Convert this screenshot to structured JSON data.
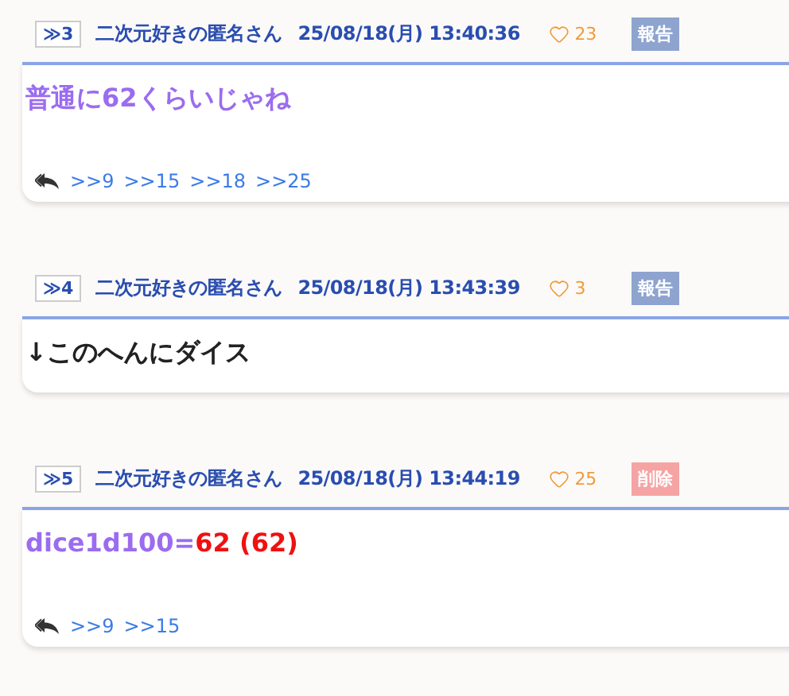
{
  "posts": [
    {
      "number": "≫3",
      "name": "二次元好きの匿名さん",
      "date": "25/08/18(月) 13:40:36",
      "likes": "23",
      "action": {
        "kind": "report",
        "label": "報告"
      },
      "body": [
        {
          "text": "普通に62くらいじゃね",
          "color": "#9b6cf0"
        }
      ],
      "replies": [
        ">>9",
        ">>15",
        ">>18",
        ">>25"
      ]
    },
    {
      "number": "≫4",
      "name": "二次元好きの匿名さん",
      "date": "25/08/18(月) 13:43:39",
      "likes": "3",
      "action": {
        "kind": "report",
        "label": "報告"
      },
      "body": [
        {
          "text": "↓このへんにダイス",
          "color": "#222222"
        }
      ]
    },
    {
      "number": "≫5",
      "name": "二次元好きの匿名さん",
      "date": "25/08/18(月) 13:44:19",
      "likes": "25",
      "action": {
        "kind": "delete",
        "label": "削除"
      },
      "body": [
        {
          "text": "dice1d100=",
          "color": "#9b6cf0"
        },
        {
          "text": "62 (62)",
          "color": "#ee1111"
        }
      ],
      "replies": [
        ">>9",
        ">>15"
      ]
    }
  ]
}
